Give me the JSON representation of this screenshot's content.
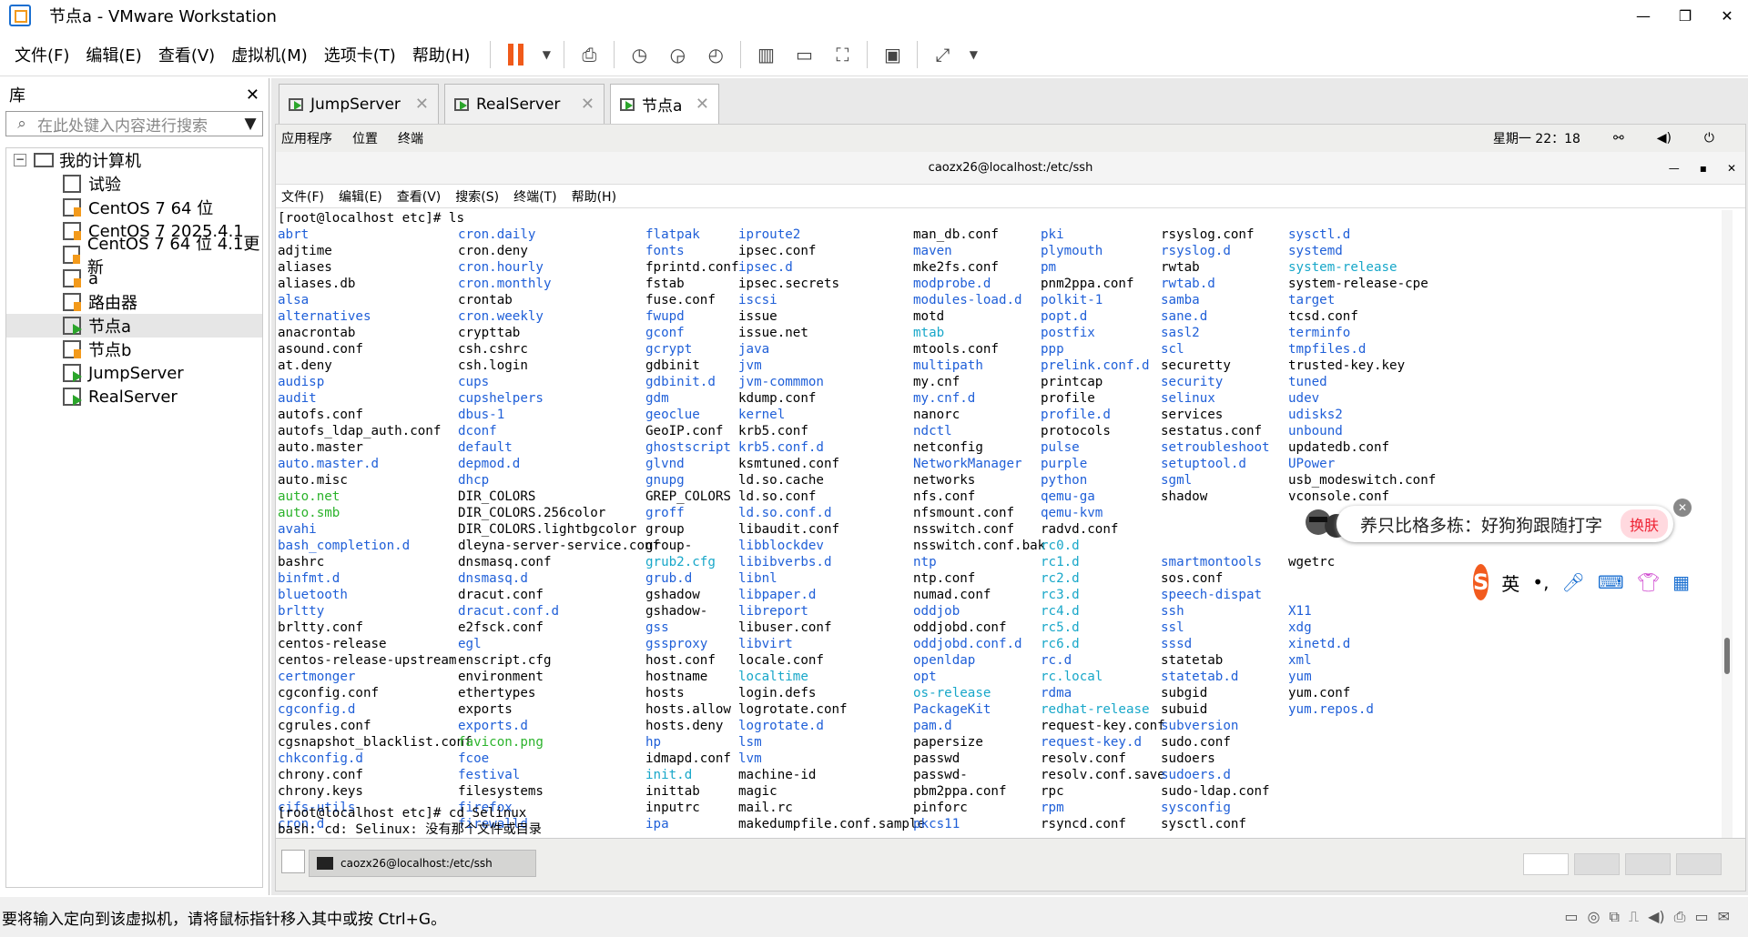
{
  "window": {
    "title": "节点a - VMware Workstation"
  },
  "menu": [
    "文件(F)",
    "编辑(E)",
    "查看(V)",
    "虚拟机(M)",
    "选项卡(T)",
    "帮助(H)"
  ],
  "library": {
    "title": "库",
    "search_placeholder": "在此处键入内容进行搜索",
    "root": "我的计算机",
    "items": [
      "试验",
      "CentOS 7 64 位",
      "CentOS 7 2025.4.1",
      "CentOS 7 64 位 4.1更新",
      "a",
      "路由器",
      "节点a",
      "节点b",
      "JumpServer",
      "RealServer"
    ]
  },
  "tabs": [
    "JumpServer",
    "RealServer",
    "节点a"
  ],
  "guest": {
    "panel": [
      "应用程序",
      "位置",
      "终端"
    ],
    "clock": "星期一 22：18"
  },
  "terminal": {
    "title": "caozx26@localhost:/etc/ssh",
    "menu": [
      "文件(F)",
      "编辑(E)",
      "查看(V)",
      "搜索(S)",
      "终端(T)",
      "帮助(H)"
    ],
    "cmd1": "[root@localhost etc]# ls",
    "cmd2": "[root@localhost etc]# cd Selinux",
    "err": "bash: cd: Selinux: 没有那个文件或目录",
    "columns": [
      [
        [
          "abrt",
          "b"
        ],
        [
          "adjtime",
          ""
        ],
        [
          "aliases",
          ""
        ],
        [
          "aliases.db",
          ""
        ],
        [
          "alsa",
          "b"
        ],
        [
          "alternatives",
          "b"
        ],
        [
          "anacrontab",
          ""
        ],
        [
          "asound.conf",
          ""
        ],
        [
          "at.deny",
          ""
        ],
        [
          "audisp",
          "b"
        ],
        [
          "audit",
          "b"
        ],
        [
          "autofs.conf",
          ""
        ],
        [
          "autofs_ldap_auth.conf",
          ""
        ],
        [
          "auto.master",
          ""
        ],
        [
          "auto.master.d",
          "b"
        ],
        [
          "auto.misc",
          ""
        ],
        [
          "auto.net",
          "g"
        ],
        [
          "auto.smb",
          "g"
        ],
        [
          "avahi",
          "b"
        ],
        [
          "bash_completion.d",
          "b"
        ],
        [
          "bashrc",
          ""
        ],
        [
          "binfmt.d",
          "b"
        ],
        [
          "bluetooth",
          "b"
        ],
        [
          "brltty",
          "b"
        ],
        [
          "brltty.conf",
          ""
        ],
        [
          "centos-release",
          ""
        ],
        [
          "centos-release-upstream",
          ""
        ],
        [
          "certmonger",
          "b"
        ],
        [
          "cgconfig.conf",
          ""
        ],
        [
          "cgconfig.d",
          "b"
        ],
        [
          "cgrules.conf",
          ""
        ],
        [
          "cgsnapshot_blacklist.conf",
          ""
        ],
        [
          "chkconfig.d",
          "b"
        ],
        [
          "chrony.conf",
          ""
        ],
        [
          "chrony.keys",
          ""
        ],
        [
          "cifs-utils",
          "b"
        ],
        [
          "cron.d",
          "b"
        ]
      ],
      [
        [
          "cron.daily",
          "b"
        ],
        [
          "cron.deny",
          ""
        ],
        [
          "cron.hourly",
          "b"
        ],
        [
          "cron.monthly",
          "b"
        ],
        [
          "crontab",
          ""
        ],
        [
          "cron.weekly",
          "b"
        ],
        [
          "crypttab",
          ""
        ],
        [
          "csh.cshrc",
          ""
        ],
        [
          "csh.login",
          ""
        ],
        [
          "cups",
          "b"
        ],
        [
          "cupshelpers",
          "b"
        ],
        [
          "dbus-1",
          "b"
        ],
        [
          "dconf",
          "b"
        ],
        [
          "default",
          "b"
        ],
        [
          "depmod.d",
          "b"
        ],
        [
          "dhcp",
          "b"
        ],
        [
          "DIR_COLORS",
          ""
        ],
        [
          "DIR_COLORS.256color",
          ""
        ],
        [
          "DIR_COLORS.lightbgcolor",
          ""
        ],
        [
          "dleyna-server-service.conf",
          ""
        ],
        [
          "dnsmasq.conf",
          ""
        ],
        [
          "dnsmasq.d",
          "b"
        ],
        [
          "dracut.conf",
          ""
        ],
        [
          "dracut.conf.d",
          "b"
        ],
        [
          "e2fsck.conf",
          ""
        ],
        [
          "egl",
          "b"
        ],
        [
          "enscript.cfg",
          ""
        ],
        [
          "environment",
          ""
        ],
        [
          "ethertypes",
          ""
        ],
        [
          "exports",
          ""
        ],
        [
          "exports.d",
          "b"
        ],
        [
          "favicon.png",
          "g"
        ],
        [
          "fcoe",
          "b"
        ],
        [
          "festival",
          "b"
        ],
        [
          "filesystems",
          ""
        ],
        [
          "firefox",
          "b"
        ],
        [
          "firewalld",
          "b"
        ]
      ],
      [
        [
          "flatpak",
          "b"
        ],
        [
          "fonts",
          "b"
        ],
        [
          "fprintd.conf",
          ""
        ],
        [
          "fstab",
          ""
        ],
        [
          "fuse.conf",
          ""
        ],
        [
          "fwupd",
          "b"
        ],
        [
          "gconf",
          "b"
        ],
        [
          "gcrypt",
          "b"
        ],
        [
          "gdbinit",
          ""
        ],
        [
          "gdbinit.d",
          "b"
        ],
        [
          "gdm",
          "b"
        ],
        [
          "geoclue",
          "b"
        ],
        [
          "GeoIP.conf",
          ""
        ],
        [
          "ghostscript",
          "b"
        ],
        [
          "glvnd",
          "b"
        ],
        [
          "gnupg",
          "b"
        ],
        [
          "GREP_COLORS",
          ""
        ],
        [
          "groff",
          "b"
        ],
        [
          "group",
          ""
        ],
        [
          "group-",
          ""
        ],
        [
          "grub2.cfg",
          "c"
        ],
        [
          "grub.d",
          "b"
        ],
        [
          "gshadow",
          ""
        ],
        [
          "gshadow-",
          ""
        ],
        [
          "gss",
          "b"
        ],
        [
          "gssproxy",
          "b"
        ],
        [
          "host.conf",
          ""
        ],
        [
          "hostname",
          ""
        ],
        [
          "hosts",
          ""
        ],
        [
          "hosts.allow",
          ""
        ],
        [
          "hosts.deny",
          ""
        ],
        [
          "hp",
          "b"
        ],
        [
          "idmapd.conf",
          ""
        ],
        [
          "init.d",
          "c"
        ],
        [
          "inittab",
          ""
        ],
        [
          "inputrc",
          ""
        ],
        [
          "ipa",
          "b"
        ]
      ],
      [
        [
          "iproute2",
          "b"
        ],
        [
          "ipsec.conf",
          ""
        ],
        [
          "ipsec.d",
          "b"
        ],
        [
          "ipsec.secrets",
          ""
        ],
        [
          "iscsi",
          "b"
        ],
        [
          "issue",
          ""
        ],
        [
          "issue.net",
          ""
        ],
        [
          "java",
          "b"
        ],
        [
          "jvm",
          "b"
        ],
        [
          "jvm-commmon",
          "b"
        ],
        [
          "kdump.conf",
          ""
        ],
        [
          "kernel",
          "b"
        ],
        [
          "krb5.conf",
          ""
        ],
        [
          "krb5.conf.d",
          "b"
        ],
        [
          "ksmtuned.conf",
          ""
        ],
        [
          "ld.so.cache",
          ""
        ],
        [
          "ld.so.conf",
          ""
        ],
        [
          "ld.so.conf.d",
          "b"
        ],
        [
          "libaudit.conf",
          ""
        ],
        [
          "libblockdev",
          "b"
        ],
        [
          "libibverbs.d",
          "b"
        ],
        [
          "libnl",
          "b"
        ],
        [
          "libpaper.d",
          "b"
        ],
        [
          "libreport",
          "b"
        ],
        [
          "libuser.conf",
          ""
        ],
        [
          "libvirt",
          "b"
        ],
        [
          "locale.conf",
          ""
        ],
        [
          "localtime",
          "c"
        ],
        [
          "login.defs",
          ""
        ],
        [
          "logrotate.conf",
          ""
        ],
        [
          "logrotate.d",
          "b"
        ],
        [
          "lsm",
          "b"
        ],
        [
          "lvm",
          "b"
        ],
        [
          "machine-id",
          ""
        ],
        [
          "magic",
          ""
        ],
        [
          "mail.rc",
          ""
        ],
        [
          "makedumpfile.conf.sample",
          ""
        ]
      ],
      [
        [
          "man_db.conf",
          ""
        ],
        [
          "maven",
          "b"
        ],
        [
          "mke2fs.conf",
          ""
        ],
        [
          "modprobe.d",
          "b"
        ],
        [
          "modules-load.d",
          "b"
        ],
        [
          "motd",
          ""
        ],
        [
          "mtab",
          "c"
        ],
        [
          "mtools.conf",
          ""
        ],
        [
          "multipath",
          "b"
        ],
        [
          "my.cnf",
          ""
        ],
        [
          "my.cnf.d",
          "b"
        ],
        [
          "nanorc",
          ""
        ],
        [
          "ndctl",
          "b"
        ],
        [
          "netconfig",
          ""
        ],
        [
          "NetworkManager",
          "b"
        ],
        [
          "networks",
          ""
        ],
        [
          "nfs.conf",
          ""
        ],
        [
          "nfsmount.conf",
          ""
        ],
        [
          "nsswitch.conf",
          ""
        ],
        [
          "nsswitch.conf.bak",
          ""
        ],
        [
          "ntp",
          "b"
        ],
        [
          "ntp.conf",
          ""
        ],
        [
          "numad.conf",
          ""
        ],
        [
          "oddjob",
          "b"
        ],
        [
          "oddjobd.conf",
          ""
        ],
        [
          "oddjobd.conf.d",
          "b"
        ],
        [
          "openldap",
          "b"
        ],
        [
          "opt",
          "b"
        ],
        [
          "os-release",
          "c"
        ],
        [
          "PackageKit",
          "b"
        ],
        [
          "pam.d",
          "b"
        ],
        [
          "papersize",
          ""
        ],
        [
          "passwd",
          ""
        ],
        [
          "passwd-",
          ""
        ],
        [
          "pbm2ppa.conf",
          ""
        ],
        [
          "pinforc",
          ""
        ],
        [
          "pkcs11",
          "b"
        ]
      ],
      [
        [
          "pki",
          "b"
        ],
        [
          "plymouth",
          "b"
        ],
        [
          "pm",
          "b"
        ],
        [
          "pnm2ppa.conf",
          ""
        ],
        [
          "polkit-1",
          "b"
        ],
        [
          "popt.d",
          "b"
        ],
        [
          "postfix",
          "b"
        ],
        [
          "ppp",
          "b"
        ],
        [
          "prelink.conf.d",
          "b"
        ],
        [
          "printcap",
          ""
        ],
        [
          "profile",
          ""
        ],
        [
          "profile.d",
          "b"
        ],
        [
          "protocols",
          ""
        ],
        [
          "pulse",
          "b"
        ],
        [
          "purple",
          "b"
        ],
        [
          "python",
          "b"
        ],
        [
          "qemu-ga",
          "b"
        ],
        [
          "qemu-kvm",
          "b"
        ],
        [
          "radvd.conf",
          ""
        ],
        [
          "rc0.d",
          "c"
        ],
        [
          "rc1.d",
          "c"
        ],
        [
          "rc2.d",
          "c"
        ],
        [
          "rc3.d",
          "c"
        ],
        [
          "rc4.d",
          "c"
        ],
        [
          "rc5.d",
          "c"
        ],
        [
          "rc6.d",
          "c"
        ],
        [
          "rc.d",
          "b"
        ],
        [
          "rc.local",
          "c"
        ],
        [
          "rdma",
          "b"
        ],
        [
          "redhat-release",
          "c"
        ],
        [
          "request-key.conf",
          ""
        ],
        [
          "request-key.d",
          "b"
        ],
        [
          "resolv.conf",
          ""
        ],
        [
          "resolv.conf.save",
          ""
        ],
        [
          "rpc",
          ""
        ],
        [
          "rpm",
          "b"
        ],
        [
          "rsyncd.conf",
          ""
        ]
      ],
      [
        [
          "rsyslog.conf",
          ""
        ],
        [
          "rsyslog.d",
          "b"
        ],
        [
          "rwtab",
          ""
        ],
        [
          "rwtab.d",
          "b"
        ],
        [
          "samba",
          "b"
        ],
        [
          "sane.d",
          "b"
        ],
        [
          "sasl2",
          "b"
        ],
        [
          "scl",
          "b"
        ],
        [
          "securetty",
          ""
        ],
        [
          "security",
          "b"
        ],
        [
          "selinux",
          "b"
        ],
        [
          "services",
          ""
        ],
        [
          "sestatus.conf",
          ""
        ],
        [
          "setroubleshoot",
          "b"
        ],
        [
          "setuptool.d",
          "b"
        ],
        [
          "sgml",
          "b"
        ],
        [
          "shadow",
          ""
        ],
        [
          "",
          ""
        ],
        [
          "",
          ""
        ],
        [
          "",
          ""
        ],
        [
          "smartmontools",
          "b"
        ],
        [
          "sos.conf",
          ""
        ],
        [
          "speech-dispat",
          "b"
        ],
        [
          "ssh",
          "b"
        ],
        [
          "ssl",
          "b"
        ],
        [
          "sssd",
          "b"
        ],
        [
          "statetab",
          ""
        ],
        [
          "statetab.d",
          "b"
        ],
        [
          "subgid",
          ""
        ],
        [
          "subuid",
          ""
        ],
        [
          "subversion",
          "b"
        ],
        [
          "sudo.conf",
          ""
        ],
        [
          "sudoers",
          ""
        ],
        [
          "sudoers.d",
          "b"
        ],
        [
          "sudo-ldap.conf",
          ""
        ],
        [
          "sysconfig",
          "b"
        ],
        [
          "sysctl.conf",
          ""
        ]
      ],
      [
        [
          "sysctl.d",
          "b"
        ],
        [
          "systemd",
          "b"
        ],
        [
          "system-release",
          "c"
        ],
        [
          "system-release-cpe",
          ""
        ],
        [
          "target",
          "b"
        ],
        [
          "tcsd.conf",
          ""
        ],
        [
          "terminfo",
          "b"
        ],
        [
          "tmpfiles.d",
          "b"
        ],
        [
          "trusted-key.key",
          ""
        ],
        [
          "tuned",
          "b"
        ],
        [
          "udev",
          "b"
        ],
        [
          "udisks2",
          "b"
        ],
        [
          "unbound",
          "b"
        ],
        [
          "updatedb.conf",
          ""
        ],
        [
          "UPower",
          "b"
        ],
        [
          "usb_modeswitch.conf",
          ""
        ],
        [
          "vconsole.conf",
          ""
        ],
        [
          "",
          ""
        ],
        [
          "",
          ""
        ],
        [
          "",
          ""
        ],
        [
          "wgetrc",
          ""
        ],
        [
          "",
          ""
        ],
        [
          "",
          ""
        ],
        [
          "X11",
          "b"
        ],
        [
          "xdg",
          "b"
        ],
        [
          "xinetd.d",
          "b"
        ],
        [
          "xml",
          "b"
        ],
        [
          "yum",
          "b"
        ],
        [
          "yum.conf",
          ""
        ],
        [
          "yum.repos.d",
          "b"
        ]
      ]
    ]
  },
  "taskbar": {
    "item": "caozx26@localhost:/etc/ssh"
  },
  "ime": {
    "text": "养只比格多栋：好狗狗跟随打字",
    "button": "换肤",
    "lang": "英"
  },
  "status": {
    "text": "要将输入定向到该虚拟机，请将鼠标指针移入其中或按 Ctrl+G。"
  }
}
